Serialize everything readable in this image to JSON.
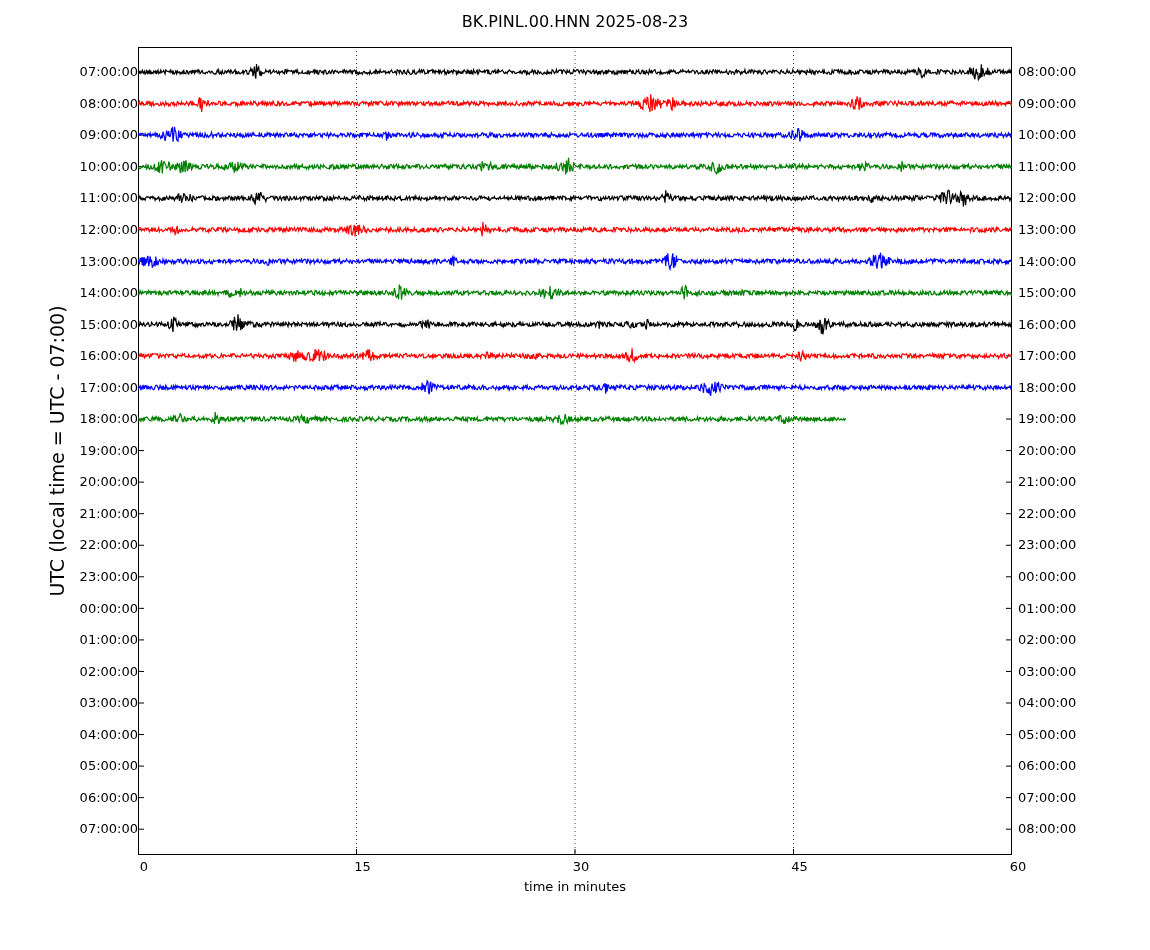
{
  "title": "BK.PINL.00.HNN 2025-08-23",
  "ylabel": "UTC (local time = UTC - 07:00)",
  "xlabel": "time in minutes",
  "xticks": [
    "0",
    "15",
    "30",
    "45",
    "60"
  ],
  "rows": [
    {
      "left": "07:00:00",
      "right": "08:00:00",
      "trace": {
        "color": "#000000",
        "level": 1
      }
    },
    {
      "left": "08:00:00",
      "right": "09:00:00",
      "trace": {
        "color": "#ff0000",
        "level": 1
      }
    },
    {
      "left": "09:00:00",
      "right": "10:00:00",
      "trace": {
        "color": "#0000ff",
        "level": 1
      }
    },
    {
      "left": "10:00:00",
      "right": "11:00:00",
      "trace": {
        "color": "#008000",
        "level": 1
      }
    },
    {
      "left": "11:00:00",
      "right": "12:00:00",
      "trace": {
        "color": "#000000",
        "level": 1
      }
    },
    {
      "left": "12:00:00",
      "right": "13:00:00",
      "trace": {
        "color": "#ff0000",
        "level": 1
      }
    },
    {
      "left": "13:00:00",
      "right": "14:00:00",
      "trace": {
        "color": "#0000ff",
        "level": 1
      }
    },
    {
      "left": "14:00:00",
      "right": "15:00:00",
      "trace": {
        "color": "#008000",
        "level": 1
      }
    },
    {
      "left": "15:00:00",
      "right": "16:00:00",
      "trace": {
        "color": "#000000",
        "level": 1
      }
    },
    {
      "left": "16:00:00",
      "right": "17:00:00",
      "trace": {
        "color": "#ff0000",
        "level": 1
      }
    },
    {
      "left": "17:00:00",
      "right": "18:00:00",
      "trace": {
        "color": "#0000ff",
        "level": 1
      }
    },
    {
      "left": "18:00:00",
      "right": "19:00:00",
      "trace": {
        "color": "#008000",
        "level": 0.81
      }
    },
    {
      "left": "19:00:00",
      "right": "20:00:00"
    },
    {
      "left": "20:00:00",
      "right": "21:00:00"
    },
    {
      "left": "21:00:00",
      "right": "22:00:00"
    },
    {
      "left": "22:00:00",
      "right": "23:00:00"
    },
    {
      "left": "23:00:00",
      "right": "00:00:00"
    },
    {
      "left": "00:00:00",
      "right": "01:00:00"
    },
    {
      "left": "01:00:00",
      "right": "02:00:00"
    },
    {
      "left": "02:00:00",
      "right": "03:00:00"
    },
    {
      "left": "03:00:00",
      "right": "04:00:00"
    },
    {
      "left": "04:00:00",
      "right": "05:00:00"
    },
    {
      "left": "05:00:00",
      "right": "06:00:00"
    },
    {
      "left": "06:00:00",
      "right": "07:00:00"
    },
    {
      "left": "07:00:00",
      "right": "08:00:00"
    }
  ]
}
